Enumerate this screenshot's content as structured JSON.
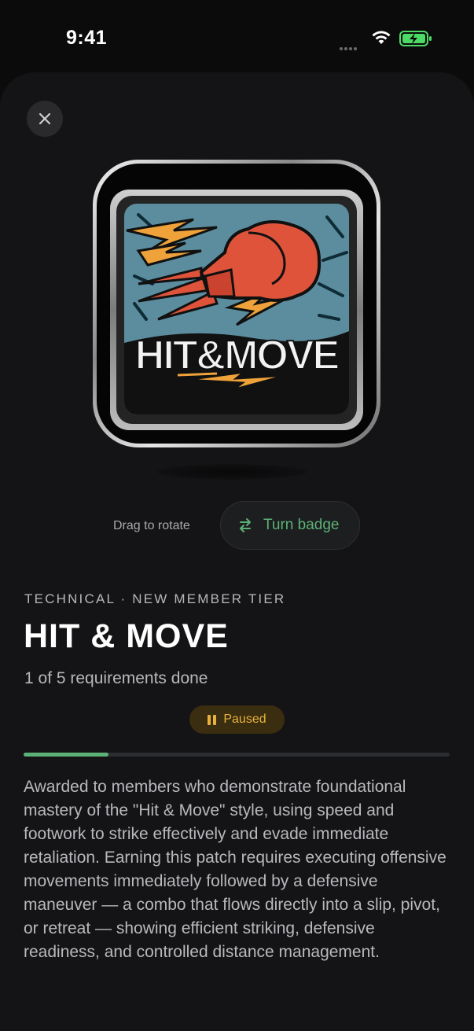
{
  "status_bar": {
    "time": "9:41"
  },
  "controls": {
    "drag_hint": "Drag to rotate",
    "turn_badge_label": "Turn badge"
  },
  "badge": {
    "category": "TECHNICAL · NEW MEMBER TIER",
    "title": "HIT & MOVE",
    "patch_text": "HIT&MOVE",
    "progress_text": "1 of 5 requirements done",
    "requirements_done": 1,
    "requirements_total": 5,
    "status": "Paused",
    "description": "Awarded to members who demonstrate foundational mastery of the \"Hit & Move\" style, using speed and footwork to strike effectively and evade immediate retaliation. Earning this patch requires executing offensive movements immediately followed by a defensive maneuver — a combo that flows directly into a slip, pivot, or retreat — showing efficient striking, defensive readiness, and controlled distance management."
  },
  "icons": [
    "close-icon",
    "swap-arrows-icon",
    "pause-icon",
    "wifi-icon",
    "battery-charging-icon",
    "boxing-glove-icon"
  ],
  "colors": {
    "accent_green": "#5cb276",
    "paused_amber": "#e8b13d",
    "patch_blue": "#5b8d9e",
    "glove_red": "#e0533b",
    "bolt_orange": "#f0a23a"
  }
}
